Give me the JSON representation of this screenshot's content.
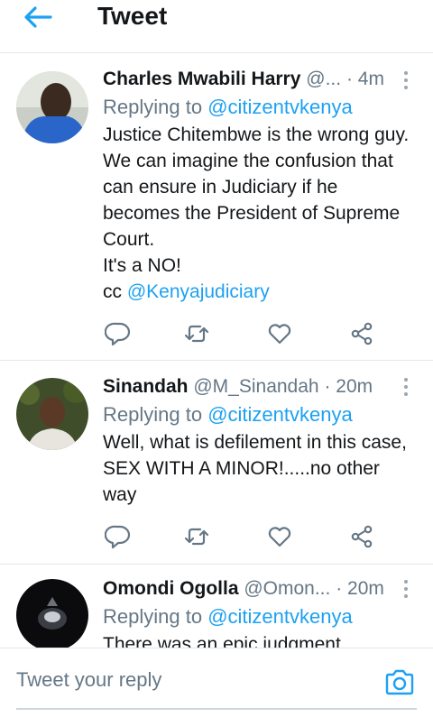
{
  "header": {
    "title": "Tweet"
  },
  "tweets": [
    {
      "name": "Charles Mwabili Harry",
      "handle": "@...",
      "dot": "·",
      "time": "4m",
      "replying_prefix": "Replying to ",
      "replying_to": "@citizentvkenya",
      "text": "Justice Chitembwe is the wrong guy. We can imagine the confusion that can ensure in Judiciary if he becomes the President of Supreme Court.\nIt's a NO!\ncc ",
      "mention": "@Kenyajudiciary"
    },
    {
      "name": "Sinandah",
      "handle": "@M_Sinandah",
      "dot": "·",
      "time": "20m",
      "replying_prefix": "Replying to ",
      "replying_to": "@citizentvkenya",
      "text": "Well, what is defilement in this case, SEX WITH A MINOR!.....no other way"
    },
    {
      "name": "Omondi Ogolla",
      "handle": "@Omon...",
      "dot": "·",
      "time": "20m",
      "replying_prefix": "Replying to ",
      "replying_to": "@citizentvkenya",
      "text": "There was an epic judgment"
    }
  ],
  "reply_bar": {
    "placeholder": "Tweet your reply"
  },
  "icons": {
    "back": "arrow-left-icon",
    "more": "more-vertical-icon",
    "reply": "reply-icon",
    "retweet": "retweet-icon",
    "like": "heart-icon",
    "share": "share-icon",
    "camera": "camera-icon"
  },
  "colors": {
    "accent": "#1da1f2",
    "muted": "#657786",
    "text": "#14171a"
  }
}
